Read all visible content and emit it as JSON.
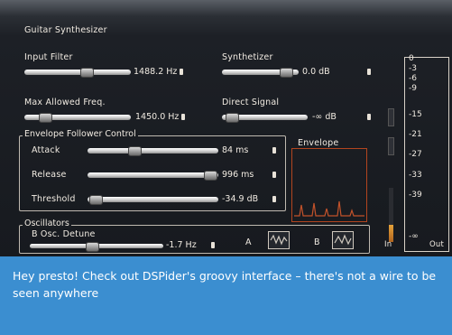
{
  "app": {
    "title": "Guitar Synthesizer"
  },
  "input_filter": {
    "label": "Input Filter",
    "value": "1488.2 Hz",
    "level": 0.55
  },
  "synthetizer": {
    "label": "Synthetizer",
    "value": "0.0 dB",
    "level": 0.78
  },
  "max_freq": {
    "label": "Max Allowed Freq.",
    "value": "1450.0 Hz",
    "level": 0.15
  },
  "direct_signal": {
    "label": "Direct Signal",
    "value": "-∞ dB",
    "level": 0.05
  },
  "envelope_follower": {
    "title": "Envelope Follower Control",
    "attack": {
      "label": "Attack",
      "value": "84 ms",
      "level": 0.32
    },
    "release": {
      "label": "Release",
      "value": "996 ms",
      "level": 0.95
    },
    "threshold": {
      "label": "Threshold",
      "value": "-34.9 dB",
      "level": 0.02
    }
  },
  "envelope_display": {
    "title": "Envelope"
  },
  "oscillators": {
    "title": "Oscillators",
    "detune": {
      "label": "B Osc. Detune",
      "value": "-1.7 Hz",
      "level": 0.45
    },
    "osc_a": {
      "label": "A",
      "icon": "waveform-icon"
    },
    "osc_b": {
      "label": "B",
      "icon": "waveform-icon"
    }
  },
  "meter": {
    "ticks": [
      "0",
      "-3",
      "-6",
      "-9",
      "-15",
      "-21",
      "-27",
      "-33",
      "-39",
      "-∞"
    ],
    "in_label": "In",
    "out_label": "Out",
    "in_level": 0.32
  },
  "caption": "Hey presto! Check out DSPider's groovy interface – there's not a wire to be seen anywhere",
  "colors": {
    "caption_bg": "#3b8ed0",
    "panel_bg": "#1a1d22",
    "envelope_accent": "#c2522a",
    "meter_fill": "#d98a2e"
  }
}
